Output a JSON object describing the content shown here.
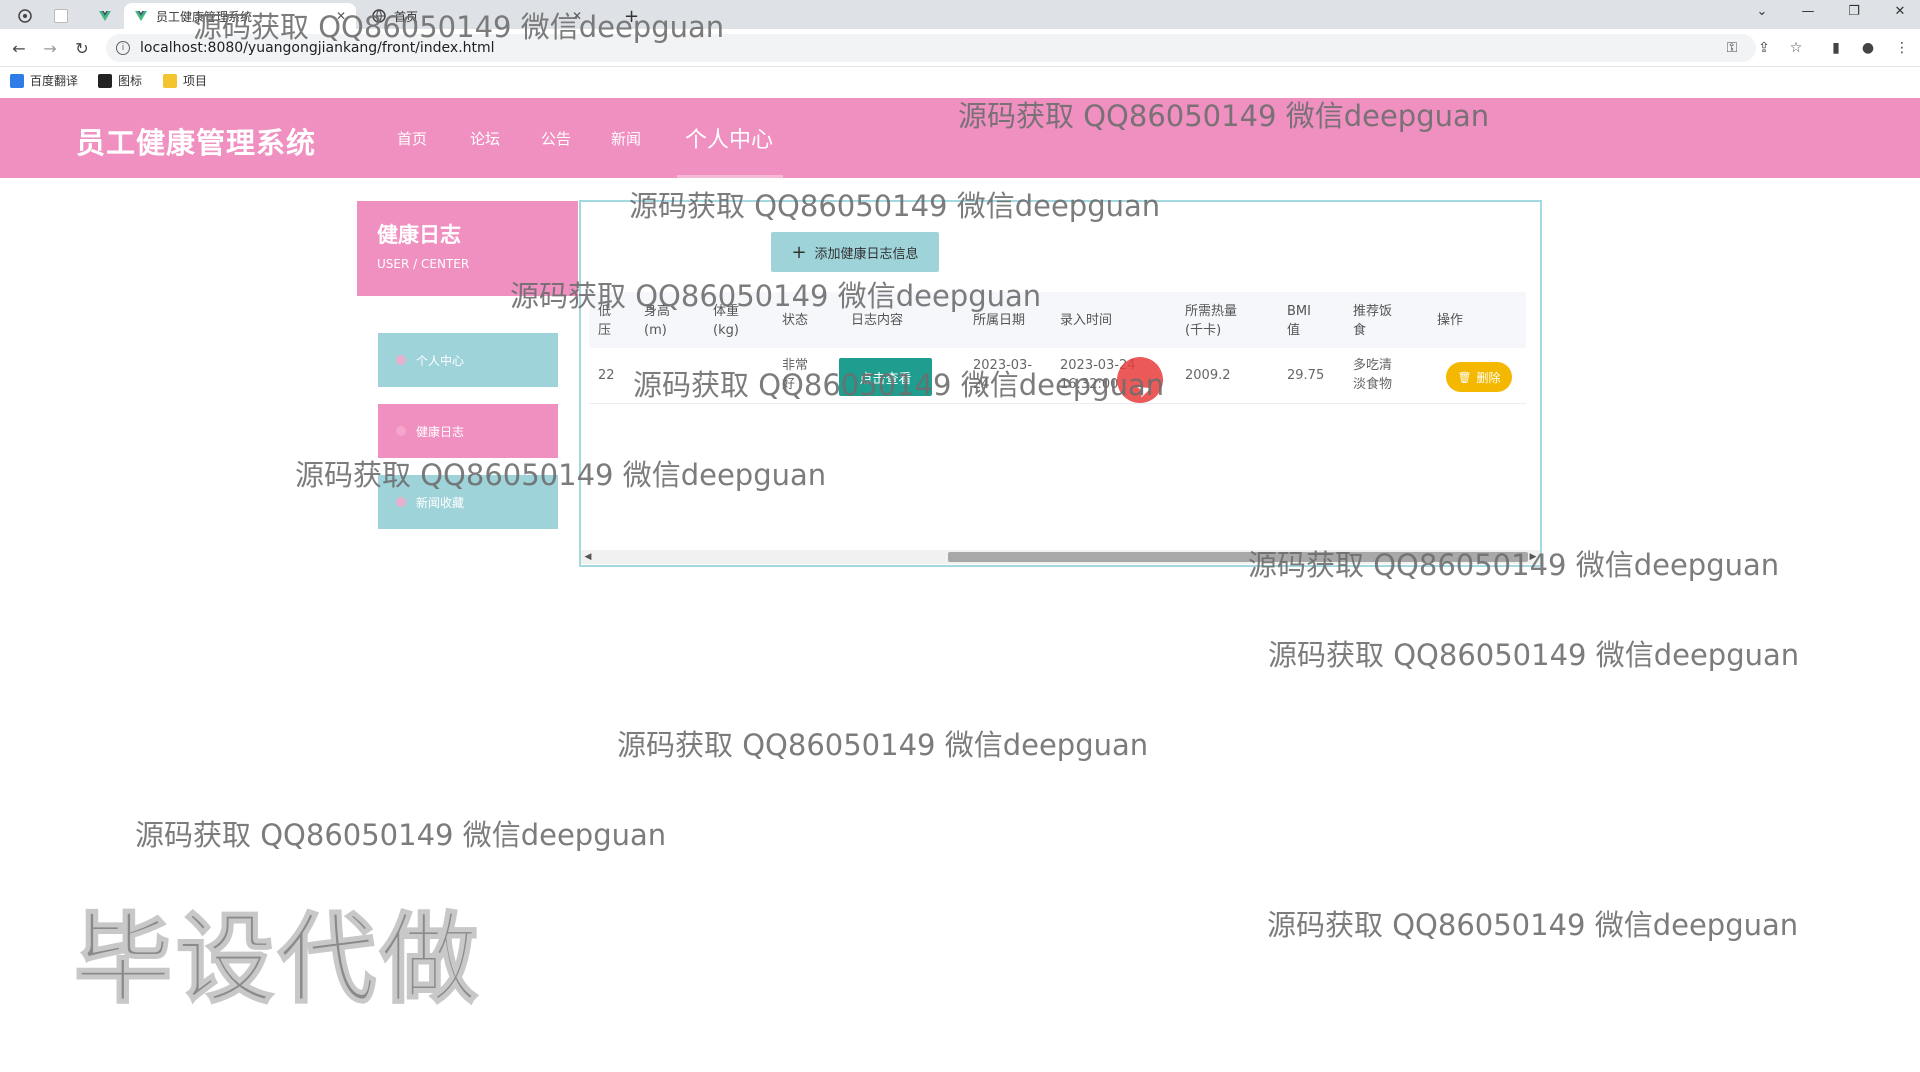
{
  "browser": {
    "tabs": [
      {
        "label": "员工健康管理系统",
        "active": true
      },
      {
        "label": "首页",
        "active": false
      }
    ],
    "new_tab_label": "+",
    "url": "localhost:8080/yuangongjiankang/front/index.html",
    "bookmarks": [
      "百度翻译",
      "图标",
      "项目"
    ]
  },
  "header": {
    "title": "员工健康管理系统",
    "nav": [
      "首页",
      "论坛",
      "公告",
      "新闻"
    ],
    "nav_active": "个人中心"
  },
  "sidebar": {
    "title": "健康日志",
    "subtitle": "USER / CENTER",
    "items": [
      {
        "label": "个人中心",
        "active": false
      },
      {
        "label": "健康日志",
        "active": true
      },
      {
        "label": "新闻收藏",
        "active": false
      }
    ]
  },
  "main": {
    "add_button": "添加健康日志信息",
    "columns": [
      "低压",
      "身高(m)",
      "体重(kg)",
      "状态",
      "日志内容",
      "所属日期",
      "录入时间",
      "所需热量(千卡)",
      "BMI值",
      "推荐饭食",
      "操作"
    ],
    "row": {
      "low_pressure": "22",
      "height": "",
      "weight": "",
      "status": "非常好",
      "view_button": "点击查看",
      "date": "2023-03-24",
      "entry_time": "2023-03-24 16:32:00",
      "calories": "2009.2",
      "bmi": "29.75",
      "recommended_food": "多吃清淡食物",
      "delete_button": "删除"
    }
  },
  "watermark": {
    "text": "源码获取 QQ86050149 微信deepguan",
    "big_text": "毕设代做"
  },
  "colors": {
    "header_pink": "#f090c0",
    "sidebar_teal": "#9fd3da",
    "view_button": "#1f9e8f",
    "delete_button": "#f5b800"
  }
}
